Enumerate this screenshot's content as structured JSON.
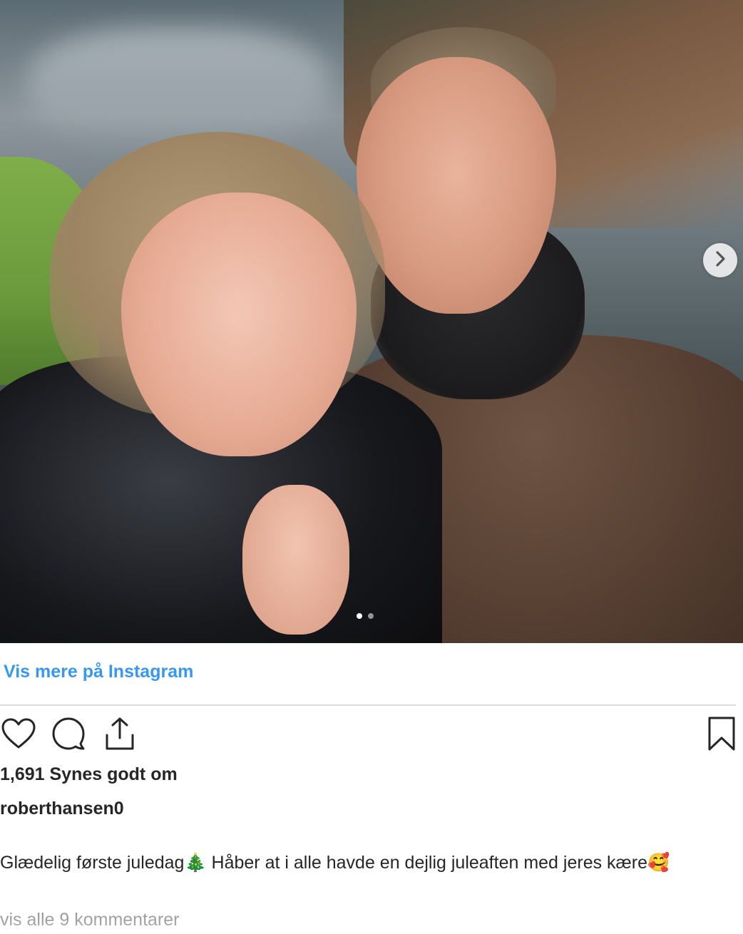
{
  "post": {
    "image_alt": "",
    "carousel": {
      "current": 1,
      "total": 2
    },
    "next_icon": "chevron-right-icon"
  },
  "links": {
    "view_more": "Vis mere på Instagram"
  },
  "actions": {
    "like_icon": "heart-icon",
    "comment_icon": "comment-icon",
    "share_icon": "share-icon",
    "save_icon": "bookmark-icon"
  },
  "stats": {
    "likes": "1,691 Synes godt om"
  },
  "author": {
    "username": "roberthansen0"
  },
  "caption": {
    "text": "Glædelig første juledag🎄 Håber at i alle havde en dejlig juleaften med jeres kære🥰"
  },
  "comments": {
    "view_all": "vis alle 9 kommentarer"
  },
  "colors": {
    "link": "#3897f0",
    "text": "#262626",
    "muted": "#8e8e8e",
    "divider": "#dbdbdb"
  }
}
